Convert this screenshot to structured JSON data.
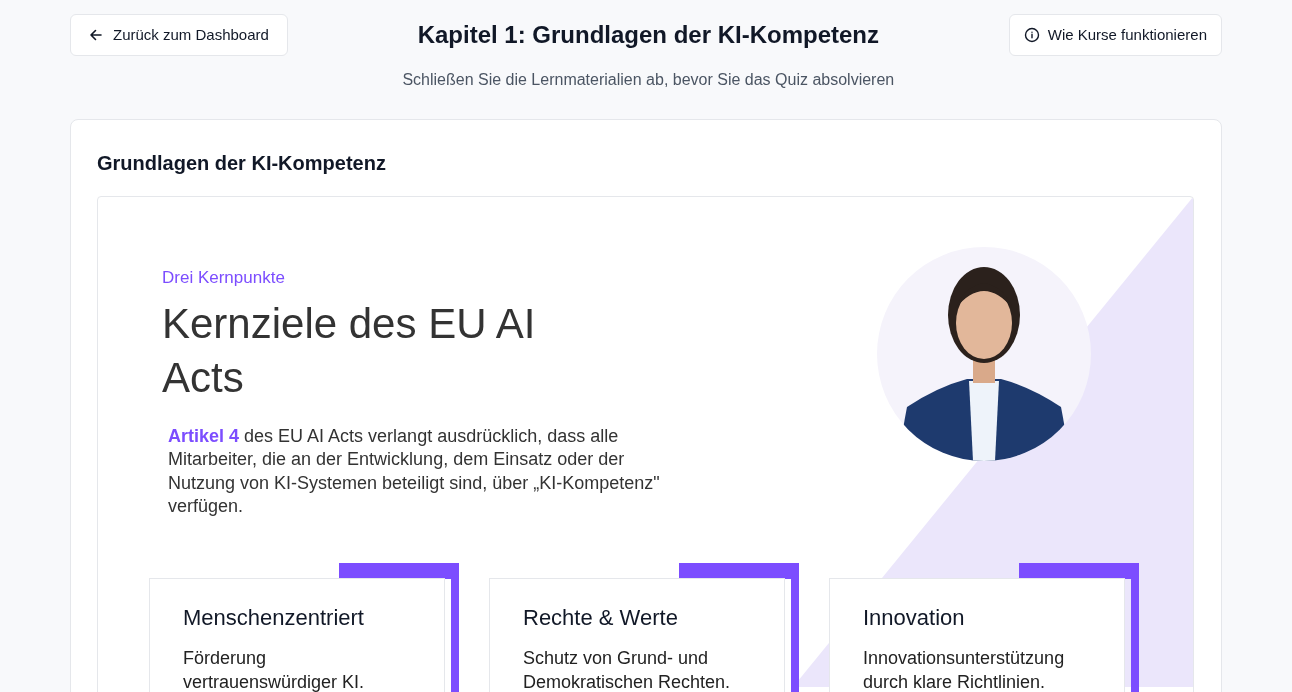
{
  "header": {
    "back_button": "Zurück zum Dashboard",
    "title": "Kapitel 1: Grundlagen der KI-Kompetenz",
    "help_button": "Wie Kurse funktionieren",
    "subtitle": "Schließen Sie die Lernmaterialien ab, bevor Sie das Quiz absolvieren"
  },
  "card": {
    "title": "Grundlagen der KI-Kompetenz",
    "slide": {
      "eyebrow": "Drei Kernpunkte",
      "heading": "Kernziele des EU AI Acts",
      "body": "**Artikel 4** des EU AI Acts verlangt ausdrücklich, dass alle Mitarbeiter, die an der Entwicklung, dem Einsatz oder der Nutzung von KI-Systemen beteiligt sind, über „KI-Kompetenz\" verfügen.",
      "points": [
        {
          "title": "Menschenzentriert",
          "text": "Förderung vertrauenswürdiger KI."
        },
        {
          "title": "Rechte & Werte",
          "text": "Schutz von Grund- und Demokratischen Rechten."
        },
        {
          "title": "Innovation",
          "text": "Innovationsunterstützung durch klare Richtlinien."
        }
      ]
    }
  }
}
